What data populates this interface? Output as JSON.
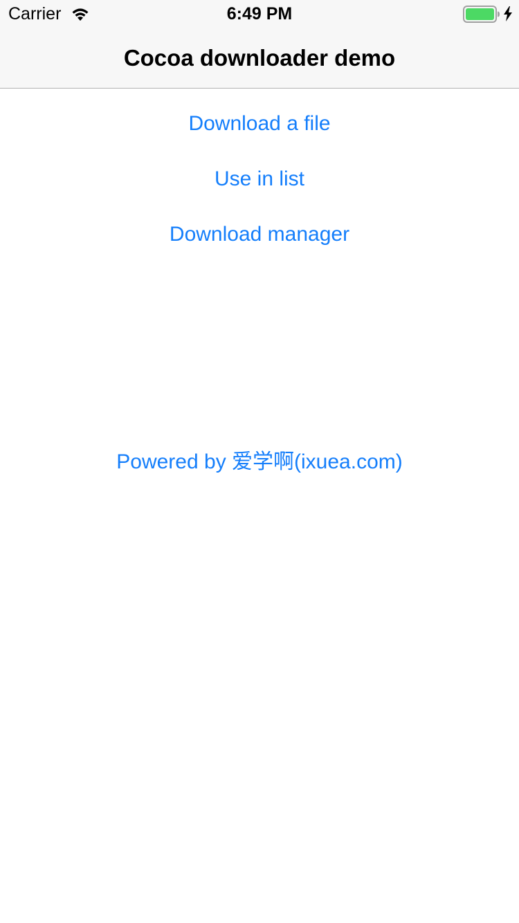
{
  "status_bar": {
    "carrier": "Carrier",
    "time": "6:49 PM",
    "wifi_icon": "wifi-icon",
    "battery_icon": "battery-icon",
    "charging_icon": "lightning-bolt-icon",
    "battery_color": "#4cd964"
  },
  "nav": {
    "title": "Cocoa downloader demo"
  },
  "menu": {
    "download_file": "Download a file",
    "use_in_list": "Use in list",
    "download_manager": "Download manager"
  },
  "footer": {
    "powered_by": "Powered by 爱学啊(ixuea.com)"
  },
  "colors": {
    "link": "#147efb",
    "bar_background": "#f7f7f7",
    "separator": "#b2b2b2"
  }
}
